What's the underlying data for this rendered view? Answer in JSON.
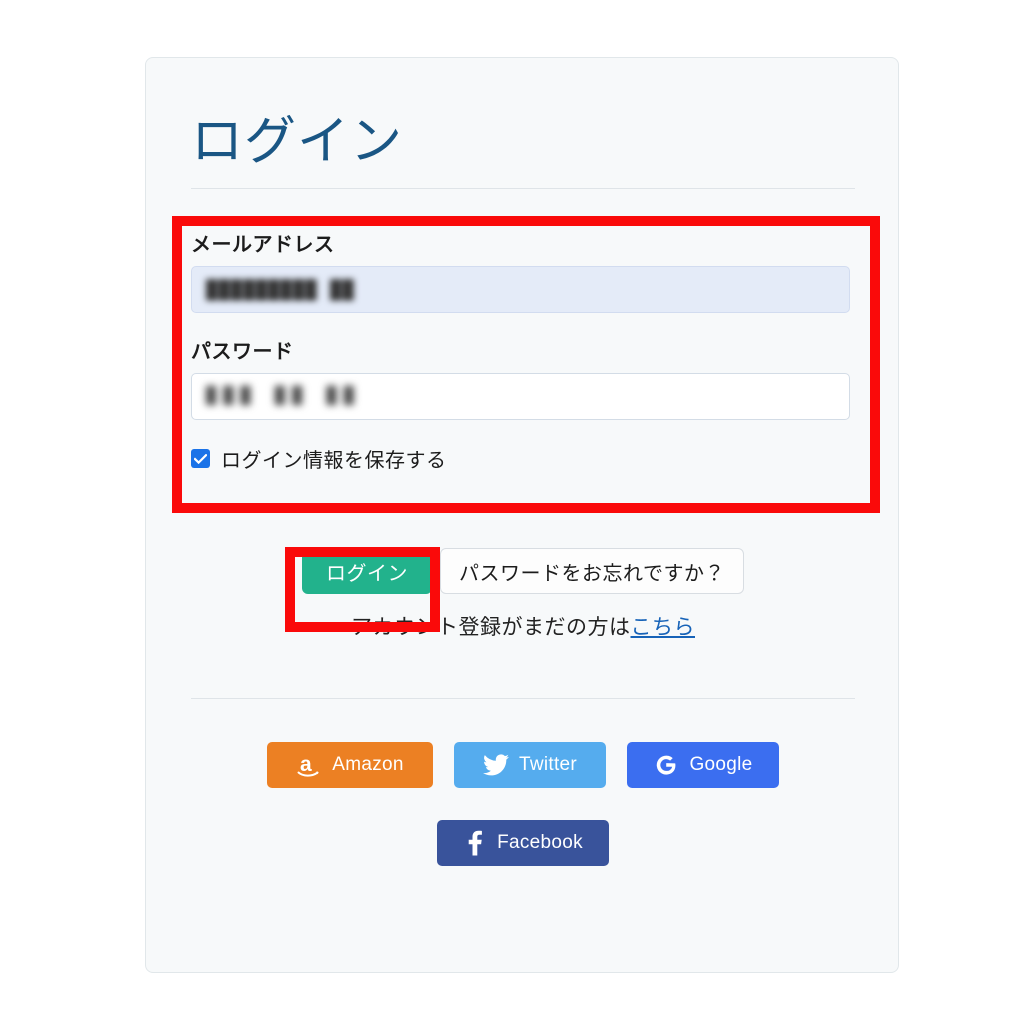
{
  "card": {
    "title": "ログイン"
  },
  "form": {
    "email": {
      "label": "メールアドレス",
      "value": "█████████ ██",
      "placeholder": "メールアドレス",
      "state": "autofilled"
    },
    "password": {
      "label": "パスワード",
      "value": "███ ██ ██",
      "placeholder": "パスワード",
      "state": "filled"
    },
    "remember": {
      "label": "ログイン情報を保存する",
      "checked": true,
      "accent_color": "#1a73e8"
    }
  },
  "actions": {
    "login_label": "ログイン",
    "login_color": "#22b28c",
    "forgot_label": "パスワードをお忘れですか？"
  },
  "register": {
    "text": "アカウント登録がまだの方は",
    "link_label": "こちら",
    "link_color": "#1763b8"
  },
  "social": {
    "row1": [
      {
        "name": "amazon",
        "label": "Amazon",
        "color": "#ec8023",
        "icon": "amazon-icon"
      },
      {
        "name": "twitter",
        "label": "Twitter",
        "color": "#55acee",
        "icon": "twitter-icon"
      },
      {
        "name": "google",
        "label": "Google",
        "color": "#3b6ef0",
        "icon": "google-icon"
      }
    ],
    "row2": [
      {
        "name": "facebook",
        "label": "Facebook",
        "color": "#39539b",
        "icon": "facebook-icon"
      }
    ]
  },
  "annotations": [
    {
      "name": "credentials-highlight",
      "color": "#fa0a0a"
    },
    {
      "name": "login-button-highlight",
      "color": "#fa0a0a"
    }
  ]
}
